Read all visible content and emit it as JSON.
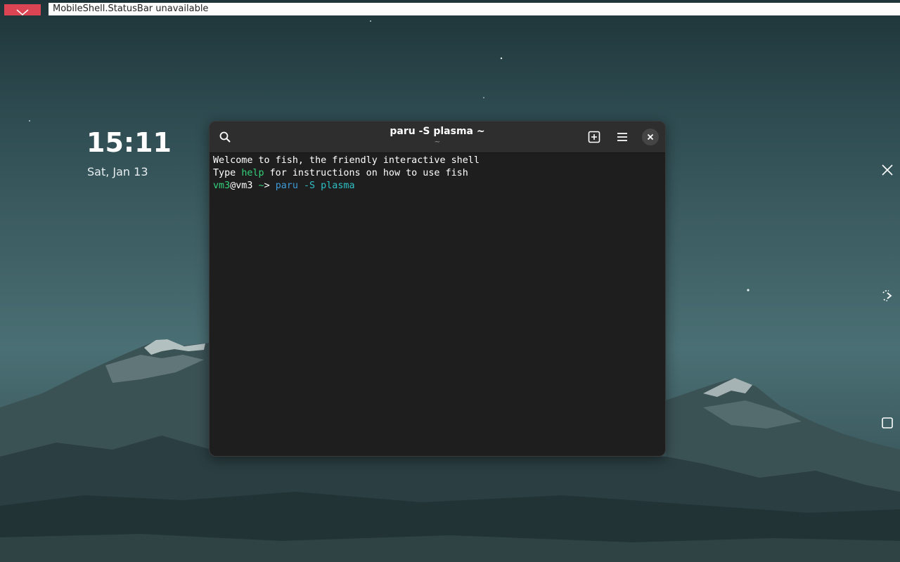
{
  "status_bar": {
    "message": "MobileShell.StatusBar unavailable"
  },
  "clock": {
    "time": "15:11",
    "date": "Sat, Jan 13"
  },
  "terminal": {
    "title": "paru -S plasma ~",
    "subtitle": "~",
    "lines": {
      "line1": "Welcome to fish, the friendly interactive shell",
      "line2_prefix": "Type ",
      "line2_cmd": "help",
      "line2_suffix": " for instructions on how to use fish",
      "prompt_user": "vm3",
      "prompt_at_host": "@vm3",
      "prompt_cwd": " ~",
      "prompt_arrow": "> ",
      "command": "paru",
      "command_args": " -S plasma"
    }
  },
  "icons": {
    "error": "error-icon",
    "search": "search-icon",
    "new_tab": "new-tab-icon",
    "menu": "hamburger-menu-icon",
    "close": "close-icon",
    "side_close": "close-icon",
    "rotate": "rotate-icon",
    "overview": "square-icon"
  },
  "colors": {
    "error_accent": "#da4453",
    "terminal_bg": "#1e1e1e",
    "headerbar_bg": "#2e2e2e",
    "fish_green": "#33d17a",
    "fish_blue": "#3e9bd8"
  }
}
